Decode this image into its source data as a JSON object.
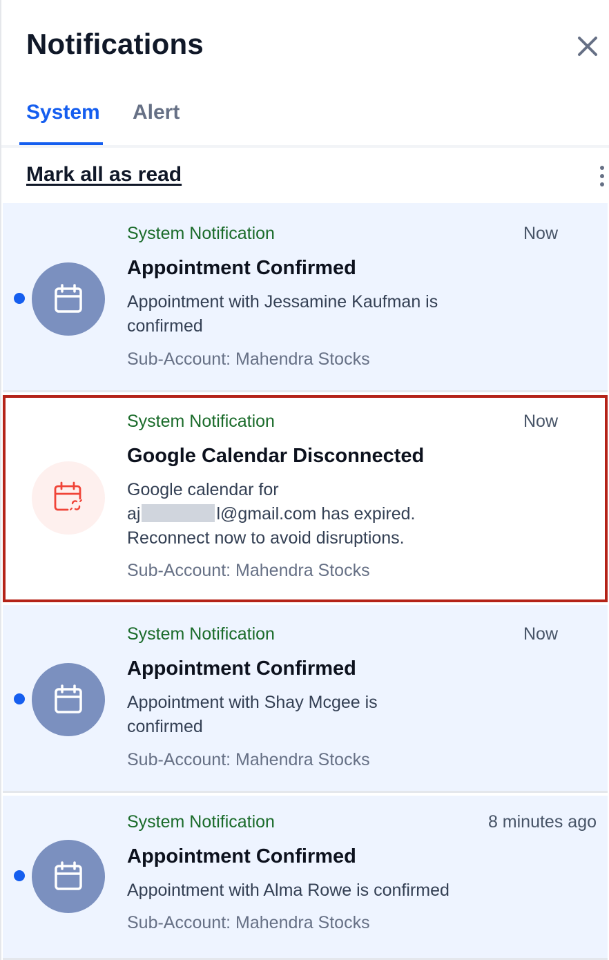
{
  "header": {
    "title": "Notifications",
    "close_icon": "close-icon"
  },
  "tabs": [
    {
      "label": "System",
      "active": true
    },
    {
      "label": "Alert",
      "active": false
    }
  ],
  "toolbar": {
    "mark_all_label": "Mark all as read",
    "more_icon": "kebab-menu-icon"
  },
  "colors": {
    "accent": "#155eef",
    "unread_bg": "#eef4ff",
    "highlight_border": "#b42318",
    "type_green": "#1a6b2a",
    "avatar_blue": "#7b90bf",
    "alert_red": "#f04438"
  },
  "notifications": [
    {
      "type": "System Notification",
      "time": "Now",
      "title": "Appointment Confirmed",
      "body_line1": "Appointment with Jessamine Kaufman is",
      "body_line2": "confirmed",
      "sub_account": "Sub-Account: Mahendra Stocks",
      "icon": "calendar-icon",
      "unread": true
    },
    {
      "type": "System Notification",
      "time": "Now",
      "title": "Google Calendar Disconnected",
      "body_line1": "Google calendar for",
      "body_email_prefix": "aj",
      "body_email_suffix": "l@gmail.com has expired.",
      "body_line3": "Reconnect now to avoid disruptions.",
      "sub_account": "Sub-Account: Mahendra Stocks",
      "icon": "calendar-disconnected-icon",
      "unread": false
    },
    {
      "type": "System Notification",
      "time": "Now",
      "title": "Appointment Confirmed",
      "body_line1": "Appointment with Shay Mcgee is",
      "body_line2": "confirmed",
      "sub_account": "Sub-Account: Mahendra Stocks",
      "icon": "calendar-icon",
      "unread": true
    },
    {
      "type": "System Notification",
      "time": "8 minutes ago",
      "title": "Appointment Confirmed",
      "body_line1": "Appointment with Alma Rowe is confirmed",
      "sub_account": "Sub-Account: Mahendra Stocks",
      "icon": "calendar-icon",
      "unread": true
    }
  ]
}
